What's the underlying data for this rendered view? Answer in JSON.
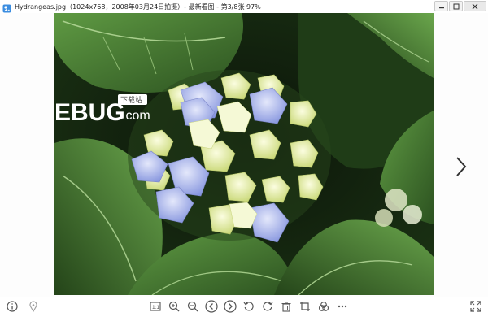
{
  "window": {
    "title": "Hydrangeas.jpg（1024x768，2008年03月24日拍摄）- 最新看图 - 第3/8张 97%"
  },
  "watermark": {
    "brand": "EBUG",
    "badge": "下载站",
    "domain": ".com"
  },
  "icons": {
    "app": "app-icon",
    "minimize": "minimize-icon",
    "maximize": "maximize-icon",
    "close": "close-icon",
    "next": "chevron-right-icon",
    "info": "info-icon",
    "location": "location-pin-icon",
    "actual_size": "actual-size-icon",
    "zoom_in": "zoom-in-icon",
    "zoom_out": "zoom-out-icon",
    "prev": "previous-icon",
    "next_image": "next-icon",
    "rotate_left": "rotate-left-icon",
    "rotate_right": "rotate-right-icon",
    "delete": "delete-icon",
    "crop": "crop-icon",
    "effects": "effects-icon",
    "more": "more-icon",
    "fullscreen": "fullscreen-icon"
  },
  "colors": {
    "toolbar_icon": "#555555",
    "leaf_dark": "#1f3a17",
    "leaf_light": "#4f8a3a",
    "petal_blue": "#8f9ee6",
    "petal_cream": "#eef3b8"
  }
}
